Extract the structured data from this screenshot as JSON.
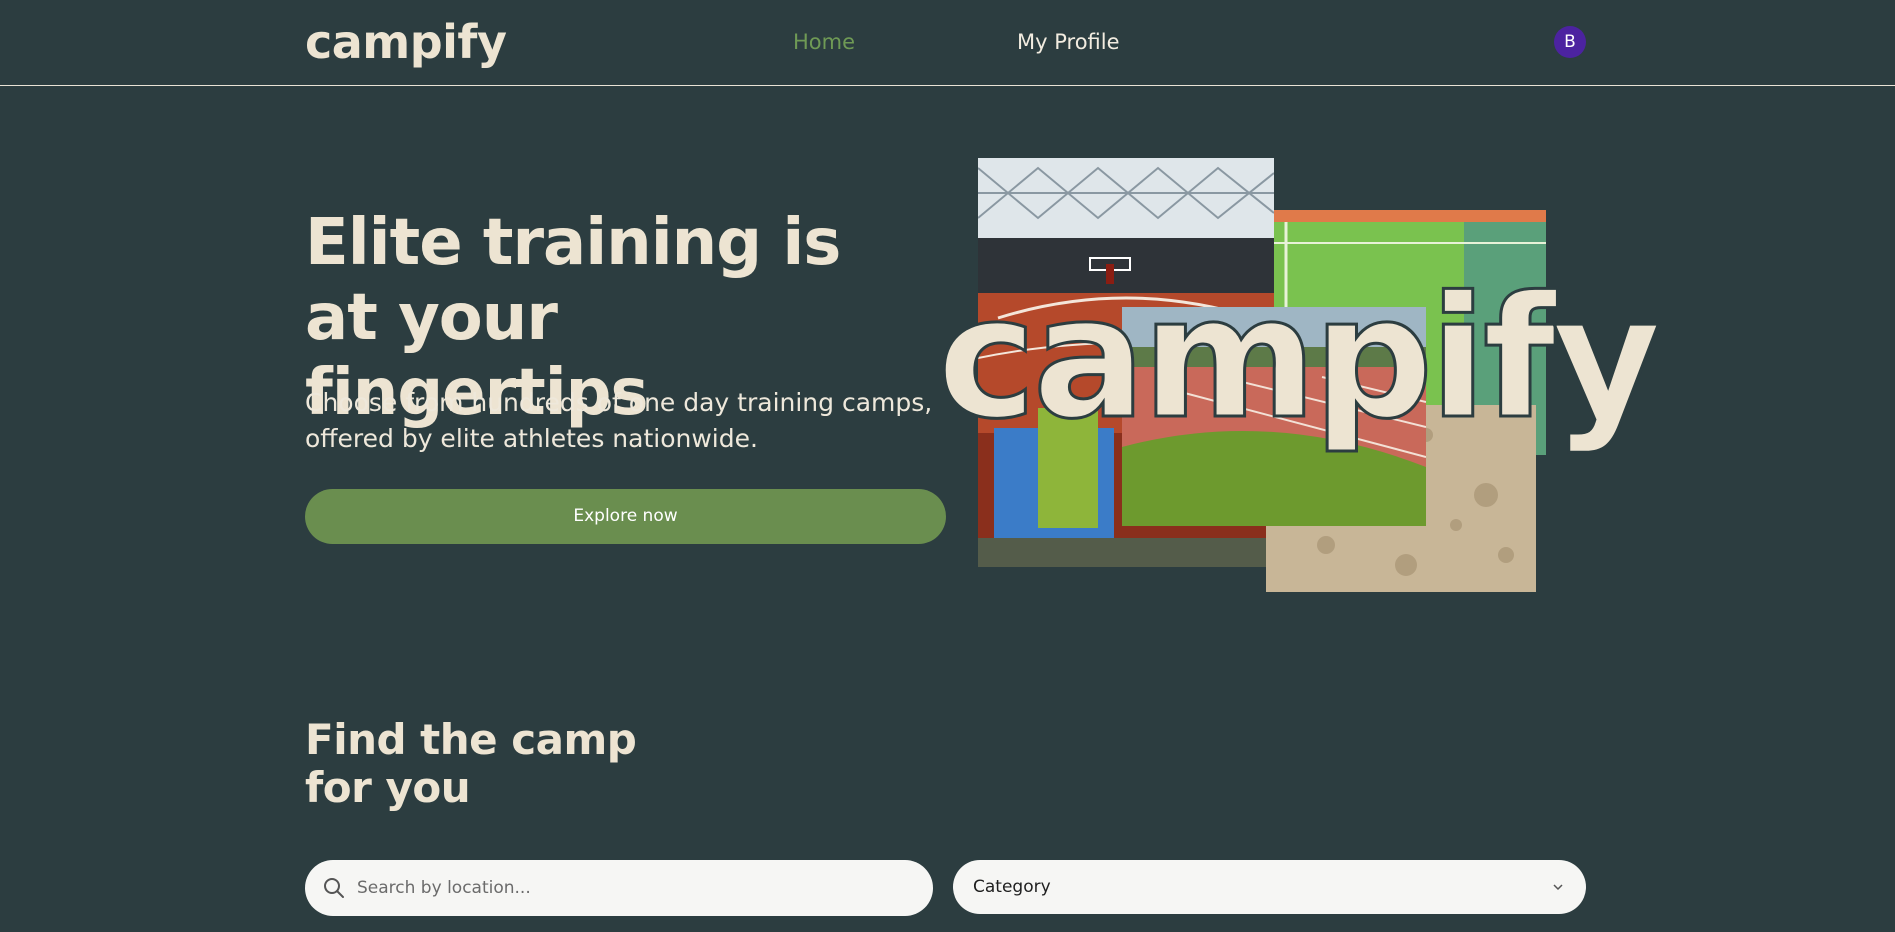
{
  "header": {
    "logo": "campify",
    "nav": {
      "home": "Home",
      "profile": "My Profile"
    },
    "avatar_initial": "B"
  },
  "hero": {
    "title": "Elite training is at your fingertips",
    "subtitle": "Choose from hundreds of one day training camps, offered by elite athletes nationwide.",
    "cta": "Explore now",
    "collage_word": "campify"
  },
  "find": {
    "title_line1": "Find the camp",
    "title_line2": "for you",
    "search_placeholder": "Search by location...",
    "category_label": "Category"
  },
  "colors": {
    "background": "#2c3d40",
    "accent": "#6a8e4f",
    "nav_active": "#6f9a55",
    "text_cream": "#ede4d2",
    "avatar": "#4c23a0"
  }
}
